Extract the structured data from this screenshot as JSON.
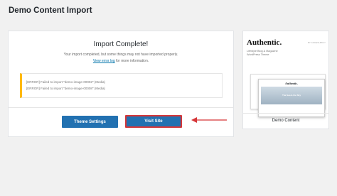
{
  "page": {
    "title": "Demo Content Import"
  },
  "result": {
    "title": "Import Complete!",
    "desc": "Your import completed, but some things may not have imported properly.",
    "log_link": "View error log",
    "log_suffix": " for more information.",
    "errors": [
      "[ERROR] Failed to import \"demo-image-00002\" (Media)",
      "[ERROR] Failed to import \"demo-image-00008\" (Media)"
    ]
  },
  "buttons": {
    "theme_settings": "Theme Settings",
    "visit_site": "Visit Site"
  },
  "demo": {
    "logo": "Authentic.",
    "tagline_1": "Lifestyle Blog & Magazine",
    "tagline_2": "WordPress Theme",
    "top_right": "BY CODESUPPLY",
    "mini_logo": "Authentic.",
    "hero_text": "The Sea & the Sky",
    "footer": "Demo Content"
  },
  "colors": {
    "primary": "#2271b1",
    "highlight": "#d63638",
    "warning": "#ffb900"
  }
}
